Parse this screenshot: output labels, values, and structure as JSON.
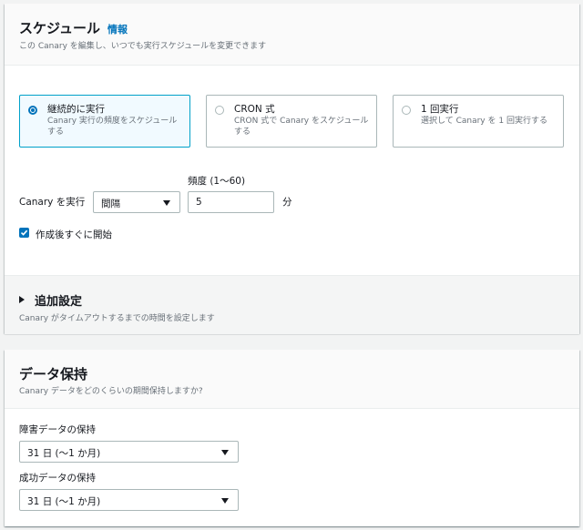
{
  "schedule": {
    "title": "スケジュール",
    "info_link": "情報",
    "description": "この Canary を編集し、いつでも実行スケジュールを変更できます",
    "options": [
      {
        "label": "継続的に実行",
        "description": "Canary 実行の頻度をスケジュールする",
        "selected": true
      },
      {
        "label": "CRON 式",
        "description": "CRON 式で Canary をスケジュールする",
        "selected": false
      },
      {
        "label": "1 回実行",
        "description": "選択して Canary を 1 回実行する",
        "selected": false
      }
    ],
    "run_label": "Canary を実行",
    "run_select_value": "間隔",
    "frequency_label": "頻度 (1〜60)",
    "frequency_value": "5",
    "frequency_unit": "分",
    "start_checkbox_label": "作成後すぐに開始",
    "start_checked": true
  },
  "advanced": {
    "title": "追加設定",
    "description": "Canary がタイムアウトするまでの時間を設定します"
  },
  "retention": {
    "title": "データ保持",
    "description": "Canary データをどのくらいの期間保持しますか?",
    "failure_label": "障害データの保持",
    "failure_value": "31 日 (〜1 か月)",
    "success_label": "成功データの保持",
    "success_value": "31 日 (〜1 か月)"
  },
  "colors": {
    "accent": "#0073bb",
    "selected_border": "#00a1c9",
    "selected_bg": "#f1faff",
    "muted_text": "#687078"
  }
}
